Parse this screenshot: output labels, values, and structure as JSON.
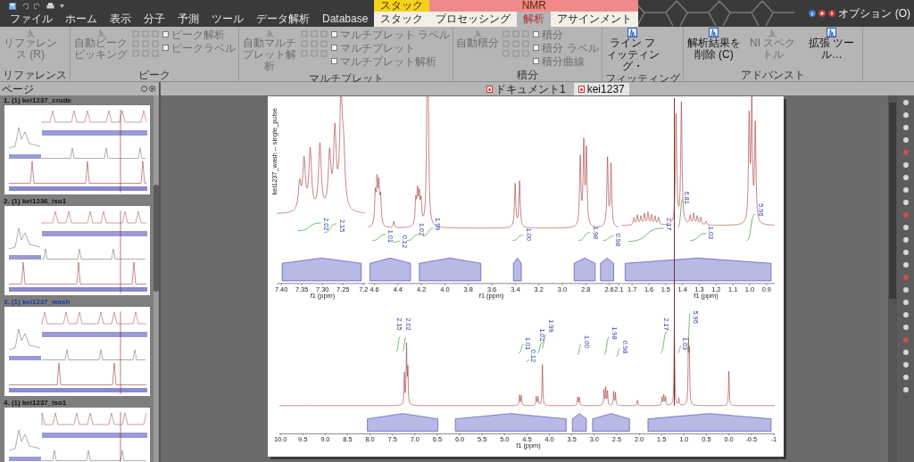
{
  "menu_tabs": [
    {
      "label": "ファイル",
      "selected": false
    },
    {
      "label": "ホーム",
      "selected": false
    },
    {
      "label": "表示",
      "selected": false
    },
    {
      "label": "分子",
      "selected": false
    },
    {
      "label": "予測",
      "selected": false
    },
    {
      "label": "ツール",
      "selected": false
    },
    {
      "label": "データ解析",
      "selected": false
    },
    {
      "label": "Database",
      "selected": false
    }
  ],
  "context_tabs": [
    {
      "label": "スタック",
      "color": "#f2d21b",
      "tabs": [
        {
          "label": "スタック",
          "selected": false
        }
      ]
    },
    {
      "label": "NMR",
      "color": "#f08a8a",
      "tabs": [
        {
          "label": "プロセッシング",
          "selected": false
        },
        {
          "label": "解析",
          "selected": true
        },
        {
          "label": "アサインメント",
          "selected": false
        }
      ]
    }
  ],
  "account": {
    "label": "オプション (O)"
  },
  "ribbon": {
    "groups": [
      {
        "label": "リファレンス",
        "items": [
          {
            "kind": "large",
            "label": "リファレンス (R)",
            "disabled": true
          }
        ]
      },
      {
        "label": "ピーク",
        "items": [
          {
            "kind": "large",
            "label": "自動ピークピッキング",
            "disabled": true
          },
          {
            "kind": "icons",
            "disabled": true
          },
          {
            "kind": "checks",
            "disabled": true,
            "checks": [
              {
                "label": "ピーク解析",
                "checked": false
              },
              {
                "label": "ピークラベル",
                "checked": false
              }
            ]
          }
        ]
      },
      {
        "label": "マルチプレット",
        "items": [
          {
            "kind": "large",
            "label": "自動マルチプレット解析",
            "disabled": true
          },
          {
            "kind": "icons",
            "disabled": true
          },
          {
            "kind": "checks",
            "disabled": true,
            "checks": [
              {
                "label": "マルチプレット ラベル",
                "checked": false
              },
              {
                "label": "マルチプレット",
                "checked": false
              },
              {
                "label": "マルチプレット解析",
                "checked": false
              }
            ]
          }
        ]
      },
      {
        "label": "積分",
        "items": [
          {
            "kind": "large",
            "label": "自動積分",
            "disabled": true
          },
          {
            "kind": "icons",
            "disabled": true
          },
          {
            "kind": "checks",
            "disabled": true,
            "checks": [
              {
                "label": "積分",
                "checked": false
              },
              {
                "label": "積分 ラベル",
                "checked": false
              },
              {
                "label": "積分曲線",
                "checked": false
              }
            ]
          }
        ]
      },
      {
        "label": "フィッティング",
        "items": [
          {
            "kind": "large",
            "label": "ライン フィッティング・",
            "disabled": false
          }
        ]
      },
      {
        "label": "アドバンスト",
        "items": [
          {
            "kind": "large",
            "label": "解析結果を削除 (C)",
            "disabled": false
          },
          {
            "kind": "large",
            "label": "NI スペクトル",
            "disabled": true
          },
          {
            "kind": "large",
            "label": "拡張 ツール…",
            "disabled": false
          }
        ]
      }
    ]
  },
  "pages_panel": {
    "title": "ページ",
    "pages": [
      {
        "label": "1. (1) kei1237_crude",
        "selected": false
      },
      {
        "label": "2. (1) kei1236_iso1",
        "selected": false
      },
      {
        "label": "3. (1) kei1237_wash",
        "selected": true
      },
      {
        "label": "4. (1) kei1237_iso1",
        "selected": false
      }
    ]
  },
  "doc_tabs": [
    {
      "label": "ドキュメント1",
      "selected": false
    },
    {
      "label": "kei1237",
      "selected": true
    }
  ],
  "spectrum": {
    "title": "kei1237_wash -- single_pulse",
    "insets": [
      {
        "axis": {
          "ticks": [
            "7.40",
            "7.35",
            "7.30",
            "7.25",
            "7.2"
          ],
          "label": "f1 (ppm)"
        },
        "integrals": [
          "2.02",
          "2.15"
        ]
      },
      {
        "axis": {
          "ticks": [
            "4.6",
            "4.4",
            "4.2",
            "4.0",
            "3.8",
            "3.6",
            "3.4",
            "3.2",
            "3.0",
            "2.8",
            "2.6",
            "2.1"
          ],
          "label": "f1 (ppm)"
        },
        "integrals": [
          "1.01",
          "0.12",
          "1.02",
          "1.99",
          "1.00",
          "1.98",
          "0.98"
        ]
      },
      {
        "axis": {
          "ticks": [
            "1.7",
            "1.6",
            "1.5",
            "1.4",
            "1.3",
            "1.2",
            "1.1",
            "1.0",
            "0.9"
          ],
          "label": "f1 (ppm)"
        },
        "integrals": [
          "2.17",
          "6.81",
          "1.03",
          "5.96"
        ]
      }
    ],
    "full": {
      "axis": {
        "ticks": [
          "10.0",
          "9.5",
          "9.0",
          "8.5",
          "8.0",
          "7.5",
          "7.0",
          "6.5",
          "6.0",
          "5.5",
          "5.0",
          "4.5",
          "4.0",
          "3.5",
          "3.0",
          "2.5",
          "2.0",
          "1.5",
          "1.0",
          "0.5",
          "0.0",
          "-0.5",
          "-1"
        ],
        "label": "f1 (ppm)"
      },
      "integrals": [
        "2.15",
        "2.02",
        "1.01",
        "0.12",
        "1.02",
        "1.99",
        "1.00",
        "1.98",
        "0.98",
        "2.17",
        "1.03",
        "5.96"
      ]
    }
  }
}
